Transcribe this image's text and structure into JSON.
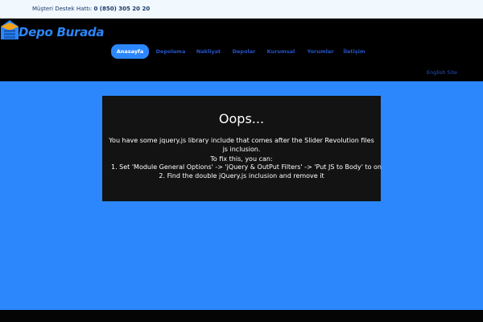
{
  "topbar": {
    "support_label": "Müşteri Destek Hattı:",
    "support_phone": "0 (850) 305 20 20"
  },
  "logo": {
    "word1": "Depo",
    "word2": "Burada"
  },
  "nav": {
    "items": [
      {
        "label": "Anasayfa",
        "active": true
      },
      {
        "label": "Depolama",
        "active": false
      },
      {
        "label": "Nakliyat",
        "active": false
      },
      {
        "label": "Depolar",
        "active": false
      },
      {
        "label": "Kurumsal",
        "active": false
      },
      {
        "label": "Yorumlar",
        "active": false
      },
      {
        "label": "İletişim",
        "active": false
      }
    ],
    "language": "English Site"
  },
  "error": {
    "title": "Oops...",
    "message": "You have some jquery.js library include that comes after the Slider Revolution files js inclusion.",
    "fix_title": "To fix this, you can:",
    "steps": [
      "1. Set 'Module General Options' -> 'jQuery & OutPut Filters' -> 'Put JS to Body' to on",
      "2. Find the double jQuery.js inclusion and remove it"
    ]
  },
  "colors": {
    "accent": "#2b87fb",
    "nav_link": "#2452c8",
    "header_bg": "#000000",
    "error_bg": "#131313"
  }
}
